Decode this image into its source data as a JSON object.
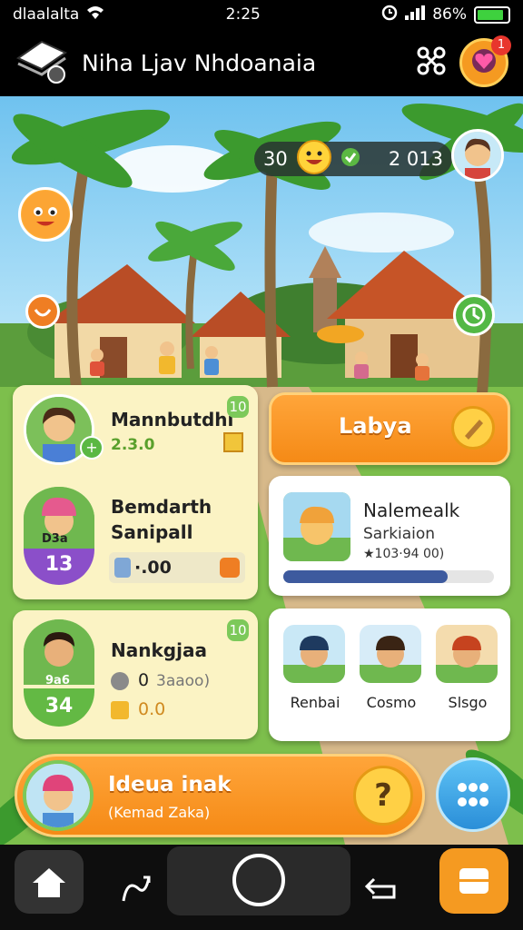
{
  "status_bar": {
    "carrier": "dlaalalta",
    "time": "2:25",
    "battery": "86%"
  },
  "app_bar": {
    "title": "Niha Ljav Nhdoanaia",
    "notification_count": "1"
  },
  "hud": {
    "left_value": "30",
    "right_value": "2 013"
  },
  "cards": {
    "player1": {
      "name": "Mannbutdhi",
      "score": "2.3.0",
      "corner": "10"
    },
    "player2": {
      "name_line1": "Bemdarth",
      "name_line2": "Sanipall",
      "cap_label": "D3a",
      "level": "13",
      "score": "·.00"
    },
    "labya_button": {
      "label": "Labya"
    },
    "task": {
      "name": "Nalemealk",
      "sub": "Sarkiaion",
      "meta": "★103·94 00)",
      "progress": 0.78
    },
    "player3": {
      "name": "Nankgjaa",
      "cap_label": "9a6",
      "level": "34",
      "stat1": "0",
      "stat1_sub": "3aaoo)",
      "stat2": "0.0",
      "corner": "10"
    },
    "friends": [
      {
        "name": "Renbai"
      },
      {
        "name": "Cosmo"
      },
      {
        "name": "Slsgo"
      }
    ]
  },
  "bottom_banner": {
    "title": "Ideua inak",
    "subtitle": "(Kemad Zaka)",
    "help": "?"
  },
  "colors": {
    "accent": "#f59a21",
    "grass": "#7dbf4c",
    "sky": "#8fd0f3",
    "progress": "#3d5a9e"
  }
}
